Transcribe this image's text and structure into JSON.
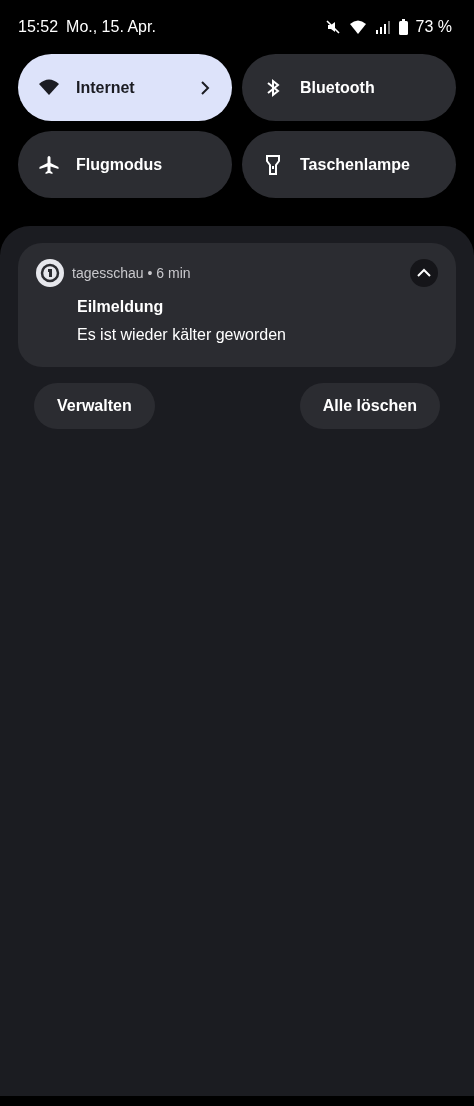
{
  "status_bar": {
    "time": "15:52",
    "date": "Mo., 15. Apr.",
    "battery_text": "73 %"
  },
  "tiles": [
    {
      "label": "Internet",
      "kind": "wifi",
      "on": true,
      "chevron": true
    },
    {
      "label": "Bluetooth",
      "kind": "bluetooth",
      "on": false,
      "chevron": false
    },
    {
      "label": "Flugmodus",
      "kind": "airplane",
      "on": false,
      "chevron": false
    },
    {
      "label": "Taschenlampe",
      "kind": "flashlight",
      "on": false,
      "chevron": false
    }
  ],
  "notification": {
    "app": "tagesschau",
    "separator": "•",
    "time": "6 min",
    "title": "Eilmeldung",
    "text": "Es ist wieder kälter geworden",
    "expanded": true
  },
  "actions": [
    "Verwalten",
    "Alle löschen"
  ]
}
